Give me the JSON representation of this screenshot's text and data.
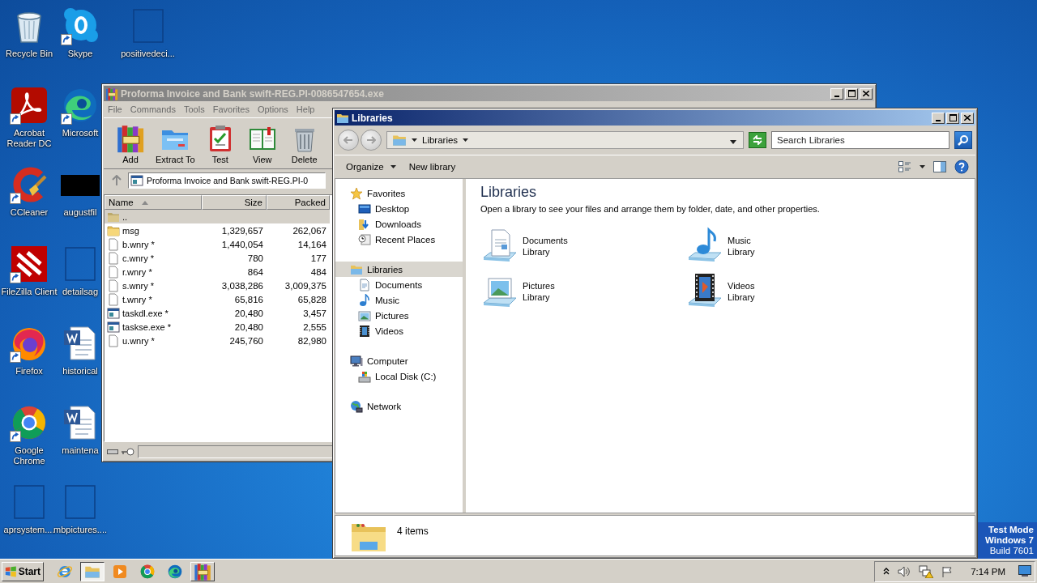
{
  "desktop_columns": [
    [
      {
        "label": "Recycle Bin",
        "kind": "recycle",
        "shortcut": false
      },
      {
        "label": "Acrobat Reader DC",
        "kind": "acrobat",
        "shortcut": true
      },
      {
        "label": "CCleaner",
        "kind": "ccleaner",
        "shortcut": true
      },
      {
        "label": "FileZilla Client",
        "kind": "filezilla",
        "shortcut": true
      },
      {
        "label": "Firefox",
        "kind": "firefox",
        "shortcut": true
      },
      {
        "label": "Google Chrome",
        "kind": "chrome",
        "shortcut": true
      },
      {
        "label": "aprsystem....",
        "kind": "blank",
        "shortcut": false
      }
    ],
    [
      {
        "label": "Skype",
        "kind": "skype",
        "shortcut": true
      },
      {
        "label": "Microsoft",
        "kind": "edge",
        "shortcut": true
      },
      {
        "label": "augustfil",
        "kind": "black",
        "shortcut": false
      },
      {
        "label": "detailsag",
        "kind": "blank",
        "shortcut": false
      },
      {
        "label": "historical",
        "kind": "word",
        "shortcut": false
      },
      {
        "label": "maintena",
        "kind": "word",
        "shortcut": false
      },
      {
        "label": "mbpictures....",
        "kind": "blank",
        "shortcut": false
      }
    ],
    [
      {
        "label": "positivedeci...",
        "kind": "blank",
        "shortcut": false
      }
    ]
  ],
  "archive_window": {
    "title": "Proforma Invoice and Bank swift-REG.PI-0086547654.exe",
    "active": false,
    "menu": [
      "File",
      "Commands",
      "Tools",
      "Favorites",
      "Options",
      "Help"
    ],
    "toolbar": [
      {
        "label": "Add",
        "kind": "add"
      },
      {
        "label": "Extract To",
        "kind": "extract"
      },
      {
        "label": "Test",
        "kind": "test"
      },
      {
        "label": "View",
        "kind": "view"
      },
      {
        "label": "Delete",
        "kind": "delete"
      }
    ],
    "path": "Proforma Invoice and Bank swift-REG.PI-0",
    "columns": [
      "Name",
      "Size",
      "Packed"
    ],
    "rows": [
      {
        "name": "..",
        "kind": "parent",
        "selected": true
      },
      {
        "name": "msg",
        "kind": "folder",
        "size": "1,329,657",
        "packed": "262,067",
        "selected": false
      },
      {
        "name": "b.wnry *",
        "kind": "file",
        "size": "1,440,054",
        "packed": "14,164",
        "selected": false
      },
      {
        "name": "c.wnry *",
        "kind": "file",
        "size": "780",
        "packed": "177",
        "selected": false
      },
      {
        "name": "r.wnry *",
        "kind": "file",
        "size": "864",
        "packed": "484",
        "selected": false
      },
      {
        "name": "s.wnry *",
        "kind": "file",
        "size": "3,038,286",
        "packed": "3,009,375",
        "selected": false
      },
      {
        "name": "t.wnry *",
        "kind": "file",
        "size": "65,816",
        "packed": "65,828",
        "selected": false
      },
      {
        "name": "taskdl.exe *",
        "kind": "exe",
        "size": "20,480",
        "packed": "3,457",
        "selected": false
      },
      {
        "name": "taskse.exe *",
        "kind": "exe",
        "size": "20,480",
        "packed": "2,555",
        "selected": false
      },
      {
        "name": "u.wnry *",
        "kind": "file",
        "size": "245,760",
        "packed": "82,980",
        "selected": false
      }
    ]
  },
  "explorer_window": {
    "title": "Libraries",
    "active": true,
    "breadcrumb": [
      "Libraries"
    ],
    "search_placeholder": "Search Libraries",
    "toolbar": [
      {
        "label": "Organize",
        "dropdown": true
      },
      {
        "label": "New library",
        "dropdown": false
      }
    ],
    "nav": [
      {
        "label": "Favorites",
        "kind": "star",
        "selected": false,
        "children": [
          {
            "label": "Desktop",
            "kind": "desktop",
            "selected": false
          },
          {
            "label": "Downloads",
            "kind": "downloads",
            "selected": false
          },
          {
            "label": "Recent Places",
            "kind": "recent",
            "selected": false
          }
        ]
      },
      {
        "label": "Libraries",
        "kind": "libraries",
        "selected": true,
        "children": [
          {
            "label": "Documents",
            "kind": "documents",
            "selected": false
          },
          {
            "label": "Music",
            "kind": "music",
            "selected": false
          },
          {
            "label": "Pictures",
            "kind": "pictures",
            "selected": false
          },
          {
            "label": "Videos",
            "kind": "videos",
            "selected": false
          }
        ]
      },
      {
        "label": "Computer",
        "kind": "computer",
        "selected": false,
        "children": [
          {
            "label": "Local Disk (C:)",
            "kind": "disk",
            "selected": false
          }
        ]
      },
      {
        "label": "Network",
        "kind": "network",
        "selected": false
      }
    ],
    "heading": "Libraries",
    "description": "Open a library to see your files and arrange them by folder, date, and other properties.",
    "libraries": [
      {
        "name": "Documents",
        "subtitle": "Library",
        "kind": "documents"
      },
      {
        "name": "Music",
        "subtitle": "Library",
        "kind": "music"
      },
      {
        "name": "Pictures",
        "subtitle": "Library",
        "kind": "pictures"
      },
      {
        "name": "Videos",
        "subtitle": "Library",
        "kind": "videos"
      }
    ],
    "status": "4 items"
  },
  "system_notice": [
    {
      "text": "Test Mode",
      "emphasis": true
    },
    {
      "text": "Windows 7",
      "emphasis": true
    },
    {
      "text": "Build 7601",
      "emphasis": false
    }
  ],
  "taskbar": {
    "start": "Start",
    "apps": [
      {
        "kind": "ie",
        "running": false,
        "selected": false
      },
      {
        "kind": "explorer",
        "running": true,
        "selected": true
      },
      {
        "kind": "wmp",
        "running": false,
        "selected": false
      },
      {
        "kind": "chrome",
        "running": false,
        "selected": false
      },
      {
        "kind": "edge",
        "running": false,
        "selected": false
      },
      {
        "kind": "winrar",
        "running": true,
        "selected": false
      }
    ],
    "clock": "7:14 PM"
  }
}
